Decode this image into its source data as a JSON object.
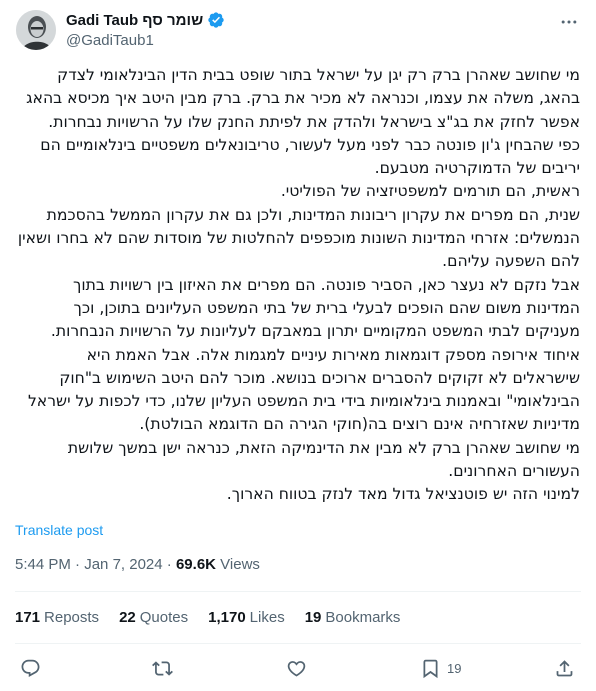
{
  "author": {
    "display_name": "Gadi Taub שומר סף",
    "handle": "@GadiTaub1",
    "verified": true,
    "verified_color": "#1d9bf0"
  },
  "more_icon": "more-horizontal-icon",
  "tweet": {
    "paragraphs": [
      "מי שחושב שאהרן ברק רק יגן על ישראל בתור שופט בבית הדין הבינלאומי לצדק בהאג, משלה את עצמו, וכנראה לא מכיר את ברק. ברק מבין היטב איך מכיסא בהאג אפשר לחזק את בג\"צ בישראל ולהדק את לפיתת החנק שלו על הרשויות נבחרות.",
      "כפי שהבחין ג'ון פונטה כבר לפני מעל לעשור, טריבונאלים משפטיים בינלאומיים הם יריבים של הדמוקרטיה מטבעם.",
      "ראשית, הם תורמים למשפטיזציה של הפוליטי.",
      "שנית, הם מפרים את עקרון ריבונות המדינות, ולכן גם את עקרון הממשל בהסכמת הנמשלים: אזרחי המדינות השונות מוכפפים להחלטות של מוסדות שהם לא בחרו ושאין להם השפעה עליהם.",
      "אבל נזקם לא נעצר כאן, הסביר פונטה. הם מפרים את האיזון בין רשויות בתוך המדינות משום שהם הופכים לבעלי ברית של בתי המשפט העליונים בתוכן, וכך מעניקים לבתי המשפט המקומיים יתרון במאבקם לעליונות על הרשויות הנבחרות.",
      "איחוד אירופה מספק דוגמאות מאירות עיניים למגמות אלה. אבל האמת היא שישראלים לא זקוקים להסברים ארוכים בנושא. מוכר להם היטב השימוש ב\"חוק הבינלאומי\" ובאמנות בינלאומיות בידי בית המשפט העליון שלנו, כדי לכפות על ישראל מדיניות שאזרחיה אינם רוצים בה(חוקי הגירה הם הדוגמא הבולטת).",
      "מי שחושב שאהרן ברק לא מבין את הדינמיקה הזאת, כנראה ישן במשך שלושת העשורים האחרונים.",
      "למינוי הזה יש פוטנציאל גדול מאד לנזק בטווח הארוך."
    ],
    "translate_label": "Translate post",
    "time": "5:44 PM",
    "separator": "·",
    "date": "Jan 7, 2024",
    "views_count": "69.6K",
    "views_label": "Views"
  },
  "stats": {
    "reposts_count": "171",
    "reposts_label": "Reposts",
    "quotes_count": "22",
    "quotes_label": "Quotes",
    "likes_count": "1,170",
    "likes_label": "Likes",
    "bookmarks_count": "19",
    "bookmarks_label": "Bookmarks"
  },
  "actions": {
    "reply_icon": "reply-icon",
    "repost_icon": "repost-icon",
    "like_icon": "like-icon",
    "bookmark_icon": "bookmark-icon",
    "bookmark_count": "19",
    "share_icon": "share-icon"
  },
  "colors": {
    "text": "#0f1419",
    "secondary": "#536471",
    "link": "#1d9bf0",
    "divider": "#eff3f4"
  }
}
